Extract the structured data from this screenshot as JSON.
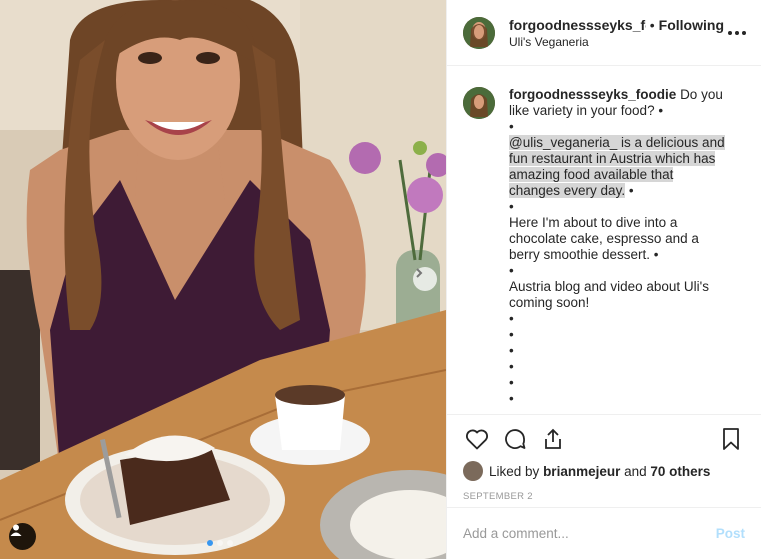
{
  "post": {
    "username": "forgoodnessseyks_foodie",
    "follow_separator": "•",
    "follow_status": "Following",
    "location": "Uli's Veganeria",
    "carousel": {
      "slides": 3,
      "active_index": 0
    }
  },
  "caption": {
    "username": "forgoodnessseyks_foodie",
    "lines": [
      {
        "text": "Do you like variety in your food? •",
        "highlight": false
      },
      {
        "text": "•",
        "highlight": false
      },
      {
        "text": "@ulis_veganeria_ is a delicious and fun restaurant in Austria which has amazing food available that changes every day.",
        "highlight": true,
        "suffix": " •"
      },
      {
        "text": "•",
        "highlight": false
      },
      {
        "text": "Here I'm about to dive into a chocolate cake, espresso and a berry smoothie dessert. •",
        "highlight": false
      },
      {
        "text": "•",
        "highlight": false
      },
      {
        "text": "Austria blog and video about Uli's coming soon!",
        "highlight": false
      },
      {
        "text": "•",
        "highlight": false
      },
      {
        "text": "•",
        "highlight": false
      },
      {
        "text": "•",
        "highlight": false
      },
      {
        "text": "•",
        "highlight": false
      },
      {
        "text": "•",
        "highlight": false
      },
      {
        "text": "•",
        "highlight": false
      }
    ]
  },
  "likes": {
    "prefix": "Liked by",
    "user": "brianmejeur",
    "middle": "and",
    "others": "70 others"
  },
  "date": "SEPTEMBER 2",
  "comment_box": {
    "placeholder": "Add a comment...",
    "post_label": "Post"
  },
  "icons": {
    "like": "heart-icon",
    "comment": "comment-icon",
    "share": "share-icon",
    "save": "bookmark-icon",
    "more": "more-options-icon",
    "next": "chevron-right-icon",
    "tag": "user-tag-icon"
  },
  "colors": {
    "accent": "#3897f0",
    "post_disabled": "#b2dffc",
    "highlight": "#d6d6d6",
    "muted": "#999999",
    "text": "#262626"
  }
}
